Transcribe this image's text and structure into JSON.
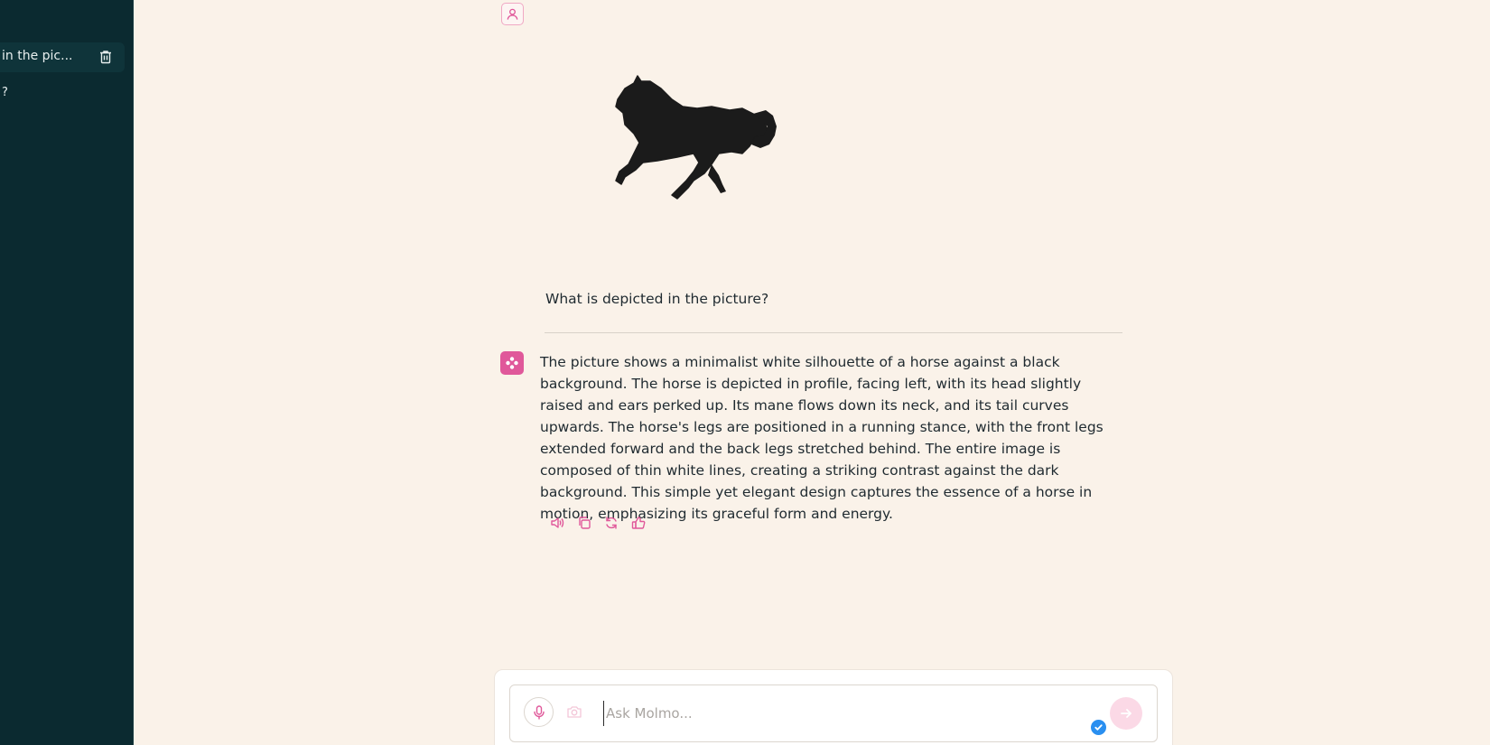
{
  "colors": {
    "sidebar_bg": "#0b2a30",
    "page_bg": "#faf2e9",
    "accent_pink": "#e0589a",
    "send_button": "#fbd9e6",
    "check_badge": "#2a8ff0"
  },
  "sidebar": {
    "items": [
      {
        "label": "in the pic...",
        "active": true,
        "icon": "trash-icon"
      },
      {
        "label": "?",
        "active": false
      }
    ]
  },
  "conversation": {
    "user_avatar_icon": "user-icon",
    "image_subject": "horse-silhouette",
    "question": "What is depicted in the picture?",
    "assistant_icon": "molmo-icon",
    "answer": "The picture shows a minimalist white silhouette of a horse against a black background. The horse is depicted in profile, facing left, with its head slightly raised and ears perked up. Its mane flows down its neck, and its tail curves upwards. The horse's legs are positioned in a running stance, with the front legs extended forward and the back legs stretched behind. The entire image is composed of thin white lines, creating a striking contrast against the dark background. This simple yet elegant design captures the essence of a horse in motion, emphasizing its graceful form and energy.",
    "actions": [
      "speaker-icon",
      "copy-icon",
      "refresh-icon",
      "thumbs-up-icon"
    ]
  },
  "composer": {
    "placeholder": "Ask Molmo...",
    "value": "",
    "mic_icon": "microphone-icon",
    "camera_icon": "camera-icon",
    "send_icon": "arrow-right-icon",
    "badge_icon": "check-icon"
  }
}
